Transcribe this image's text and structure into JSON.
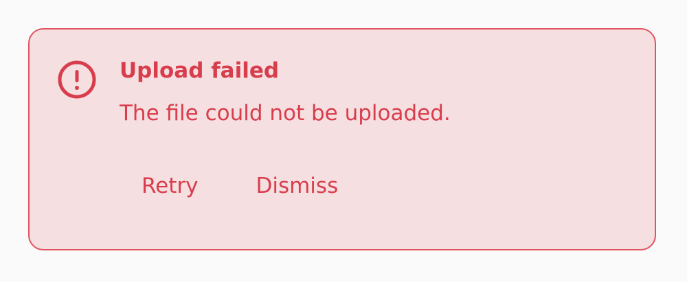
{
  "alert": {
    "icon": "exclamation-circle-icon",
    "title": "Upload failed",
    "message": "The file could not be uploaded.",
    "actions": {
      "retry_label": "Retry",
      "dismiss_label": "Dismiss"
    }
  },
  "colors": {
    "background": "#fafafa",
    "alert_background": "#f6dfe1",
    "alert_border": "#e0535f",
    "alert_text": "#d83d4c"
  }
}
